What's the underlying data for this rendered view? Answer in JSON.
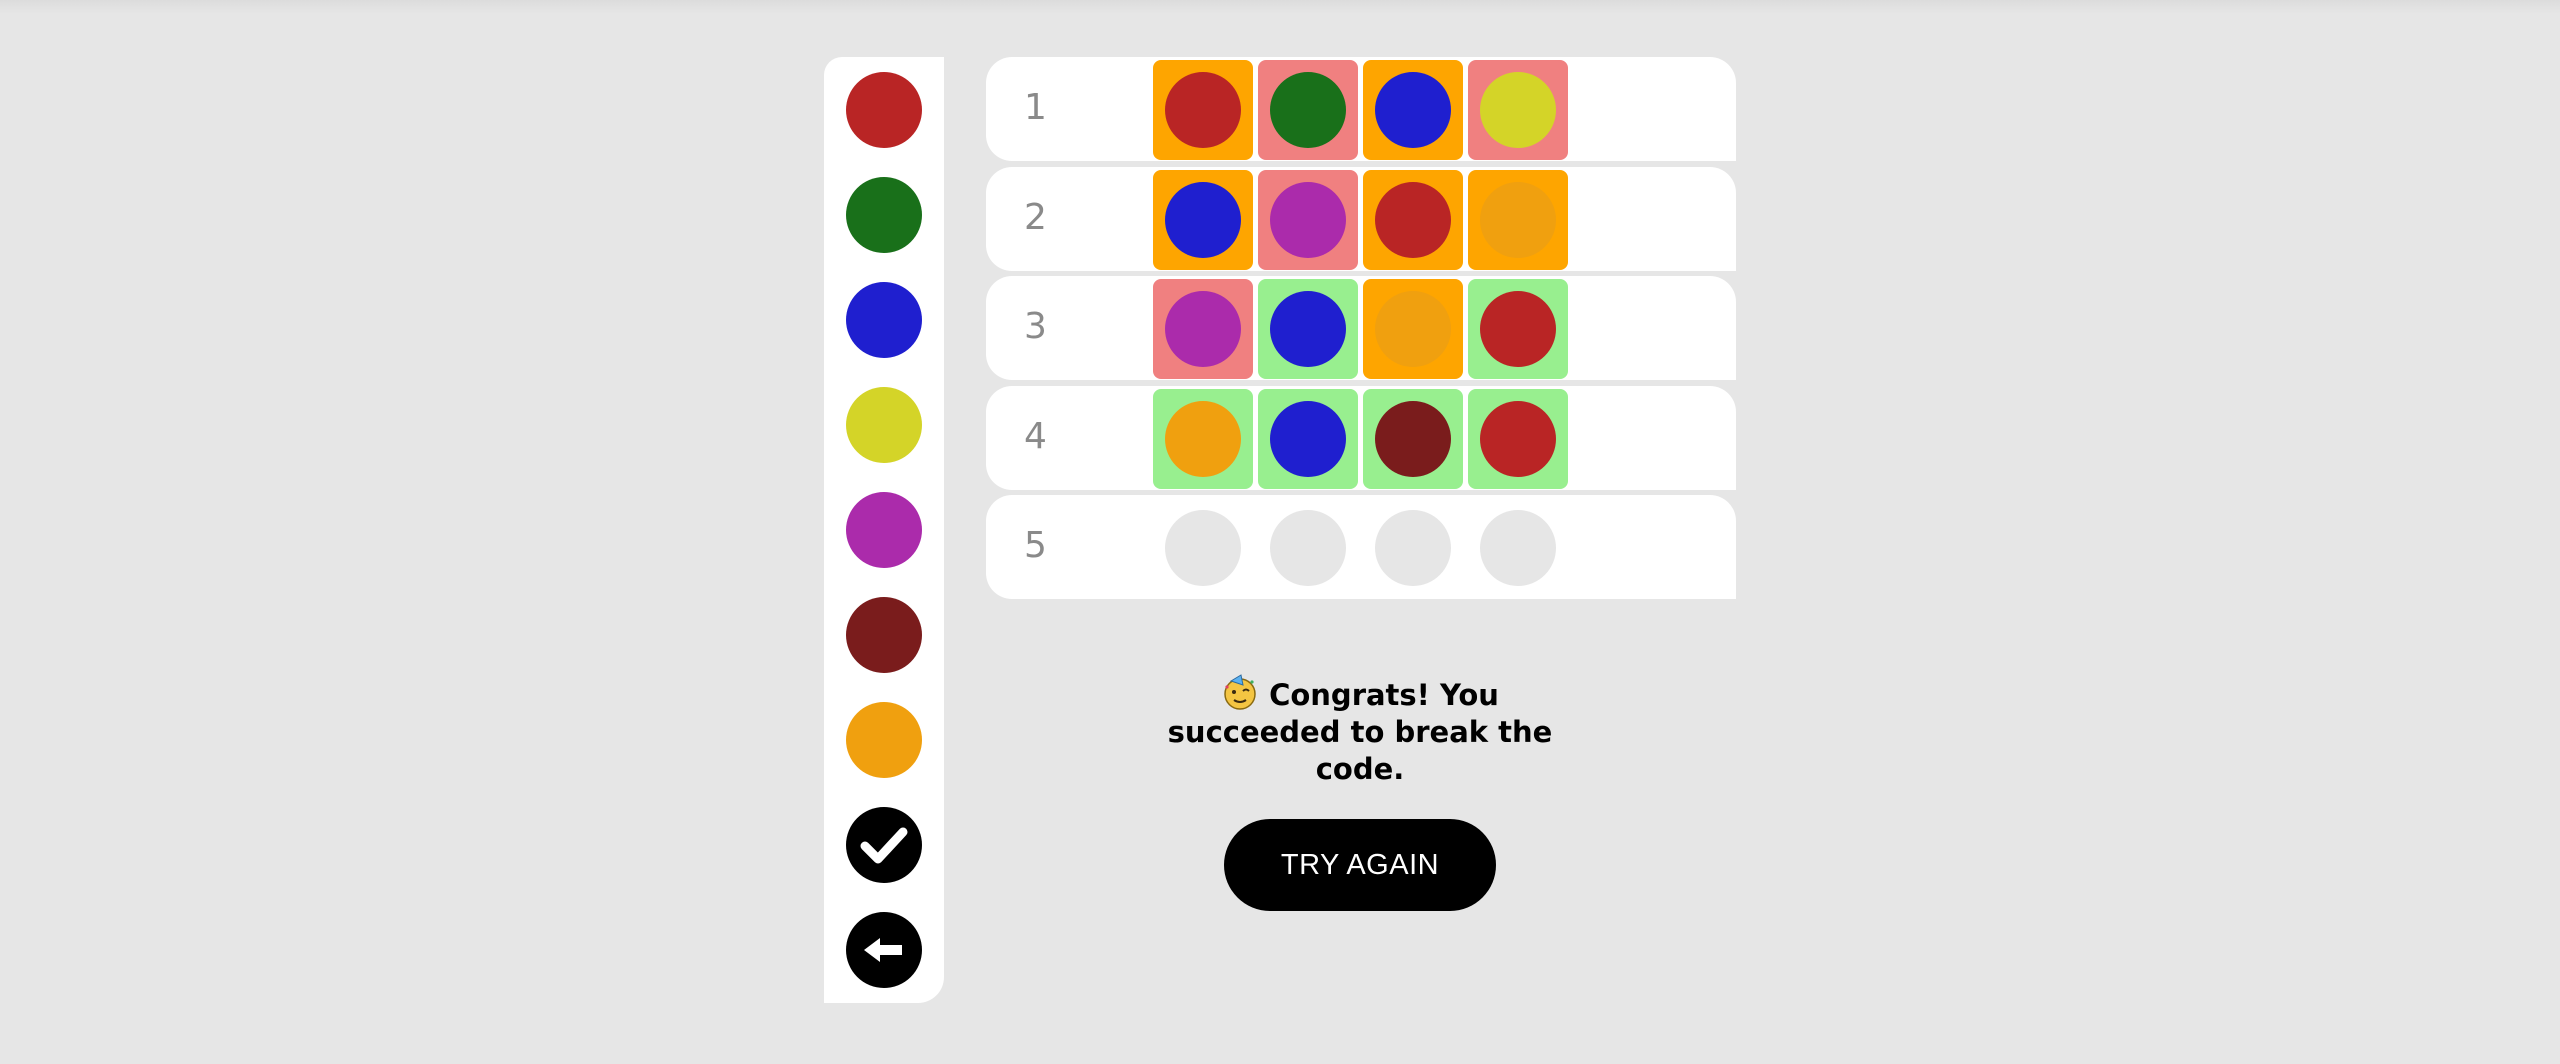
{
  "palette": {
    "colors": [
      {
        "name": "red",
        "hex": "#b92525"
      },
      {
        "name": "green",
        "hex": "#19701a"
      },
      {
        "name": "blue",
        "hex": "#1f1fcf"
      },
      {
        "name": "yellow",
        "hex": "#d4d428"
      },
      {
        "name": "purple",
        "hex": "#ab2bab"
      },
      {
        "name": "maroon",
        "hex": "#7a1c1c"
      },
      {
        "name": "orange",
        "hex": "#f0a00f"
      }
    ],
    "confirm_icon": "checkmark-icon",
    "back_icon": "backspace-arrow-icon"
  },
  "feedback_colors": {
    "correct": "#98ef8f",
    "wrong_position": "#fea500",
    "absent": "#f08080",
    "empty_peg": "#e6e6e6"
  },
  "rows": [
    {
      "number": "1",
      "pegs": [
        {
          "color": "#b92525",
          "feedback": "wrong_position"
        },
        {
          "color": "#19701a",
          "feedback": "absent"
        },
        {
          "color": "#1f1fcf",
          "feedback": "wrong_position"
        },
        {
          "color": "#d4d428",
          "feedback": "absent"
        }
      ]
    },
    {
      "number": "2",
      "pegs": [
        {
          "color": "#1f1fcf",
          "feedback": "wrong_position"
        },
        {
          "color": "#ab2bab",
          "feedback": "absent"
        },
        {
          "color": "#b92525",
          "feedback": "wrong_position"
        },
        {
          "color": "#f0a00f",
          "feedback": "wrong_position"
        }
      ]
    },
    {
      "number": "3",
      "pegs": [
        {
          "color": "#ab2bab",
          "feedback": "absent"
        },
        {
          "color": "#1f1fcf",
          "feedback": "correct"
        },
        {
          "color": "#f0a00f",
          "feedback": "wrong_position"
        },
        {
          "color": "#b92525",
          "feedback": "correct"
        }
      ]
    },
    {
      "number": "4",
      "pegs": [
        {
          "color": "#f0a00f",
          "feedback": "correct"
        },
        {
          "color": "#1f1fcf",
          "feedback": "correct"
        },
        {
          "color": "#7a1c1c",
          "feedback": "correct"
        },
        {
          "color": "#b92525",
          "feedback": "correct"
        }
      ]
    },
    {
      "number": "5",
      "pegs": [
        {
          "color": "#e6e6e6",
          "feedback": "none"
        },
        {
          "color": "#e6e6e6",
          "feedback": "none"
        },
        {
          "color": "#e6e6e6",
          "feedback": "none"
        },
        {
          "color": "#e6e6e6",
          "feedback": "none"
        }
      ]
    }
  ],
  "result": {
    "emoji_icon": "party-face-icon",
    "message": "Congrats! You succeeded to break the code.",
    "try_again_label": "TRY AGAIN"
  }
}
